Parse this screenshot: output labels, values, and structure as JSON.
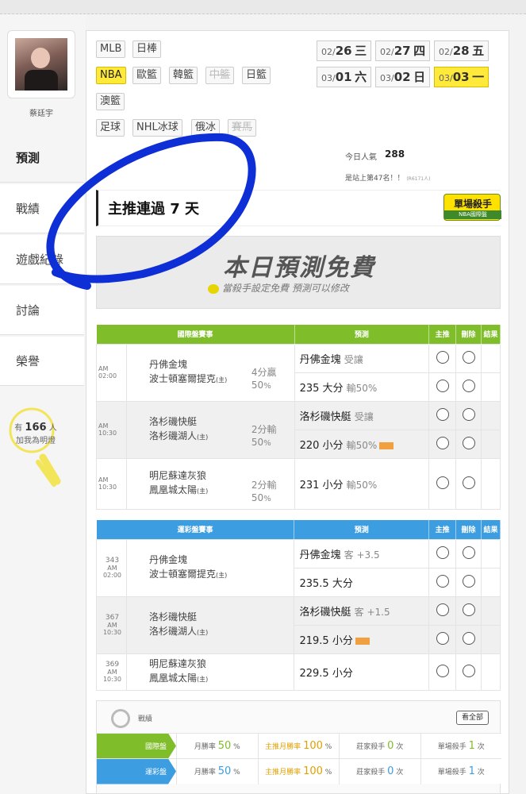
{
  "user": {
    "name": "蔡廷宇"
  },
  "nav": [
    {
      "label": "預測",
      "active": true
    },
    {
      "label": "戰績"
    },
    {
      "label": "遊戲紀錄"
    },
    {
      "label": "討論"
    },
    {
      "label": "榮譽"
    }
  ],
  "fans": {
    "prefix": "有",
    "count": "166",
    "unit": "人",
    "line2": "加我為明燈"
  },
  "leagues": [
    "MLB",
    "日棒",
    "NBA",
    "歐籃",
    "韓籃",
    "中籃",
    "日籃",
    "澳籃",
    "足球",
    "NHL冰球",
    "俄冰",
    "賽馬"
  ],
  "dates": [
    {
      "md": "02/",
      "d": "26",
      "wd": "三"
    },
    {
      "md": "02/",
      "d": "27",
      "wd": "四"
    },
    {
      "md": "02/",
      "d": "28",
      "wd": "五"
    },
    {
      "md": "03/",
      "d": "01",
      "wd": "六"
    },
    {
      "md": "03/",
      "d": "02",
      "wd": "日"
    },
    {
      "md": "03/",
      "d": "03",
      "wd": "一"
    }
  ],
  "popularity": {
    "label": "今日人氣",
    "value": "288",
    "rank": "是站上第47名！！",
    "rank_small": "(R6171人)"
  },
  "streak": "主推連過 7 天",
  "badge": {
    "title": "單場殺手",
    "sub": "NBA國際盤"
  },
  "free": {
    "title": "本日預測免費",
    "sub": "當殺手設定免費 預測可以修改"
  },
  "intl": {
    "headers": [
      "國際盤賽事",
      "預測",
      "主推",
      "刪除",
      "結果"
    ],
    "games": [
      {
        "time": "AM 02:00",
        "away": "丹佛金塊",
        "home": "波士頓塞爾提克",
        "home_tag": "(主)",
        "line": "4分贏",
        "pct": "50",
        "pct_unit": "%",
        "preds": [
          {
            "main": "丹佛金塊",
            "note": "受讓"
          },
          {
            "main": "235 大分",
            "note": "輸50%"
          }
        ]
      },
      {
        "time": "AM 10:30",
        "away": "洛杉磯快艇",
        "home": "洛杉磯湖人",
        "home_tag": "(主)",
        "line": "2分輸",
        "pct": "50",
        "pct_unit": "%",
        "preds": [
          {
            "main": "洛杉磯快艇",
            "note": "受讓"
          },
          {
            "main": "220 小分",
            "note": "輸50%"
          }
        ]
      },
      {
        "time": "AM 10:30",
        "away": "明尼蘇達灰狼",
        "home": "鳳凰城太陽",
        "home_tag": "(主)",
        "line": "2分輸",
        "pct": "50",
        "pct_unit": "%",
        "preds": [
          {
            "main": "231 小分",
            "note": "輸50%"
          }
        ]
      }
    ]
  },
  "lottery": {
    "headers": [
      "運彩盤賽事",
      "預測",
      "主推",
      "刪除",
      "結果"
    ],
    "games": [
      {
        "no": "343",
        "time": "AM 02:00",
        "away": "丹佛金塊",
        "home": "波士頓塞爾提克",
        "home_tag": "(主)",
        "preds": [
          {
            "main": "丹佛金塊",
            "note": "客 +3.5"
          },
          {
            "main": "235.5 大分",
            "note": ""
          }
        ]
      },
      {
        "no": "367",
        "time": "AM 10:30",
        "away": "洛杉磯快艇",
        "home": "洛杉磯湖人",
        "home_tag": "(主)",
        "preds": [
          {
            "main": "洛杉磯快艇",
            "note": "客 +1.5"
          },
          {
            "main": "219.5 小分",
            "note": ""
          }
        ]
      },
      {
        "no": "369",
        "time": "AM 10:30",
        "away": "明尼蘇達灰狼",
        "home": "鳳凰城太陽",
        "home_tag": "(主)",
        "preds": [
          {
            "main": "229.5 小分",
            "note": ""
          }
        ]
      }
    ]
  },
  "stats": {
    "title": "戰績",
    "view_all": "看全部",
    "rows": [
      {
        "label": "國際盤",
        "month_label": "月勝率",
        "month": "50",
        "main_label": "主推月勝率",
        "main": "100",
        "pct": "%",
        "dealer_label": "莊家殺手",
        "dealer": "0",
        "single_label": "單場殺手",
        "single": "1",
        "times": "次"
      },
      {
        "label": "運彩盤",
        "month_label": "月勝率",
        "month": "50",
        "main_label": "主推月勝率",
        "main": "100",
        "pct": "%",
        "dealer_label": "莊家殺手",
        "dealer": "0",
        "single_label": "單場殺手",
        "single": "1",
        "times": "次"
      }
    ]
  },
  "colors": {
    "green": "#7fbd2a",
    "blue": "#3c9de0",
    "yellow": "#ffe93b"
  }
}
